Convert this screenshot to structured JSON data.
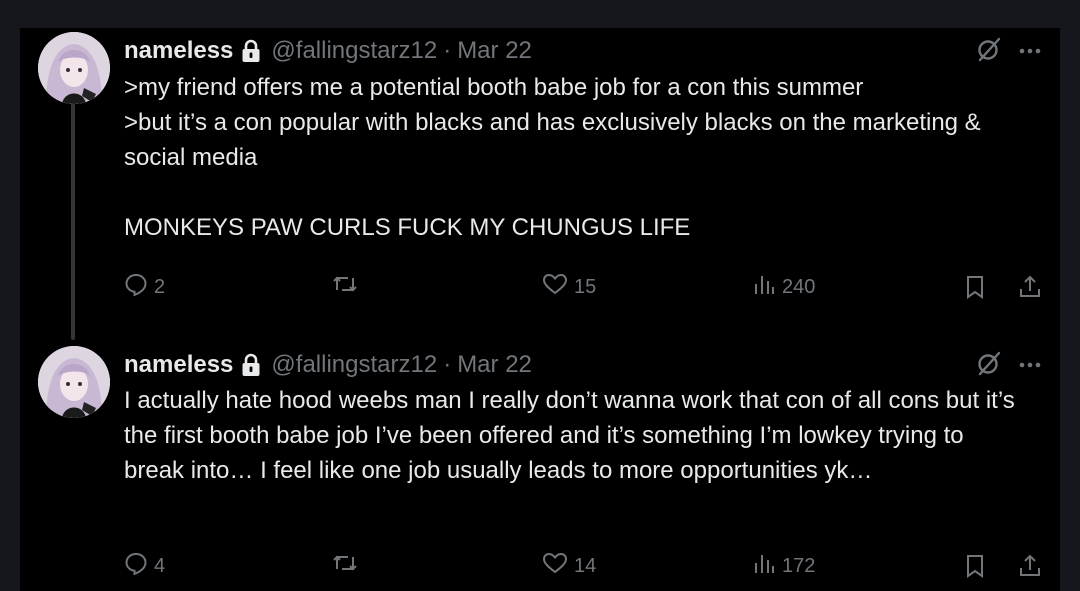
{
  "tweets": [
    {
      "display_name": "nameless",
      "handle": "@fallingstarz12",
      "separator": "·",
      "date": "Mar 22",
      "text": ">my friend offers me a potential booth babe job for a con this summer\n>but it’s a con popular with blacks and has exclusively blacks on the marketing & social media\n\nMONKEYS PAW CURLS FUCK MY CHUNGUS LIFE",
      "replies": "2",
      "retweets": "",
      "likes": "15",
      "views": "240"
    },
    {
      "display_name": "nameless",
      "handle": "@fallingstarz12",
      "separator": "·",
      "date": "Mar 22",
      "text": "I actually hate hood weebs man I really don’t wanna work that con of all cons but it’s the first booth babe job I’ve been offered and it’s something I’m lowkey trying to break into… I feel like one job usually leads to more opportunities yk…",
      "replies": "4",
      "retweets": "",
      "likes": "14",
      "views": "172"
    }
  ],
  "colors": {
    "background": "#000000",
    "outer": "#15171c",
    "text": "#e7e9ea",
    "muted": "#71767b",
    "thread_line": "#333639"
  },
  "icons": [
    "lock-icon",
    "grok-icon",
    "more-icon",
    "reply-icon",
    "retweet-icon",
    "like-icon",
    "views-icon",
    "bookmark-icon",
    "share-icon"
  ]
}
